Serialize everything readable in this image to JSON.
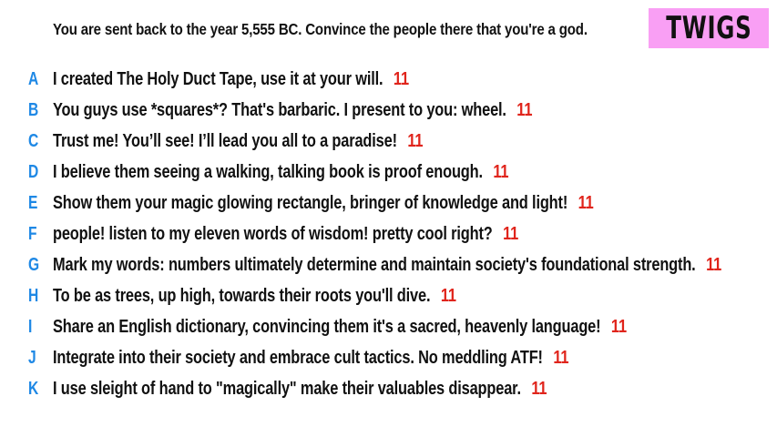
{
  "prompt": "You are sent back to the year 5,555 BC. Convince the people there that you're a god.",
  "logo": "TWIGS",
  "colors": {
    "letter": "#1e88e5",
    "count": "#e0241b",
    "logo_bg": "#f99ff4"
  },
  "answers": [
    {
      "letter": "A",
      "text": "I created The Holy Duct Tape, use it at your will.",
      "count": "11"
    },
    {
      "letter": "B",
      "text": "You guys use *squares*? That's barbaric. I present to you: wheel.",
      "count": "11"
    },
    {
      "letter": "C",
      "text": "Trust me! You’ll see! I’ll lead you all to a paradise!",
      "count": "11"
    },
    {
      "letter": "D",
      "text": "I believe them seeing a walking, talking book is proof enough.",
      "count": "11"
    },
    {
      "letter": "E",
      "text": "Show them your magic glowing rectangle, bringer of knowledge and light!",
      "count": "11"
    },
    {
      "letter": "F",
      "text": "people! listen to my eleven words of wisdom! pretty cool right?",
      "count": "11"
    },
    {
      "letter": "G",
      "text": "Mark my words: numbers ultimately determine and maintain society's foundational strength.",
      "count": "11"
    },
    {
      "letter": "H",
      "text": "To be as trees, up high, towards their roots you'll dive.",
      "count": "11"
    },
    {
      "letter": "I",
      "text": "Share an English dictionary, convincing them it's a sacred, heavenly language!",
      "count": "11"
    },
    {
      "letter": "J",
      "text": "Integrate into their society and embrace cult tactics. No meddling ATF!",
      "count": "11"
    },
    {
      "letter": "K",
      "text": "I use sleight of hand to \"magically\" make their valuables disappear.",
      "count": "11"
    }
  ]
}
